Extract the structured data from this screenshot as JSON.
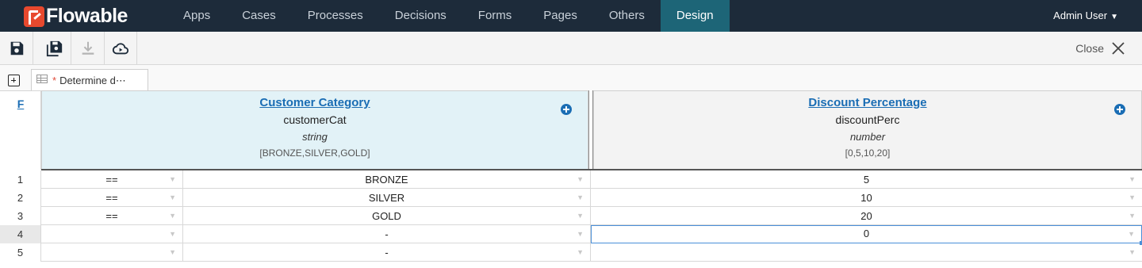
{
  "app": {
    "brand": "Flowable",
    "nav": [
      "Apps",
      "Cases",
      "Processes",
      "Decisions",
      "Forms",
      "Pages",
      "Others",
      "Design"
    ],
    "active_nav": "Design",
    "user": "Admin User"
  },
  "toolbar": {
    "buttons": [
      "save-icon",
      "save-all-icon",
      "download-icon",
      "cloud-publish-icon"
    ],
    "close_label": "Close"
  },
  "tab": {
    "modified_marker": "*",
    "title": "Determine d⋯"
  },
  "table": {
    "hit_policy": "F",
    "input_column": {
      "label": "Customer Category",
      "variable": "customerCat",
      "type": "string",
      "values": "[BRONZE,SILVER,GOLD]"
    },
    "output_column": {
      "label": "Discount Percentage",
      "variable": "discountPerc",
      "type": "number",
      "values": "[0,5,10,20]"
    },
    "rows": [
      {
        "num": "1",
        "op": "==",
        "input": "BRONZE",
        "output": "5"
      },
      {
        "num": "2",
        "op": "==",
        "input": "SILVER",
        "output": "10"
      },
      {
        "num": "3",
        "op": "==",
        "input": "GOLD",
        "output": "20"
      },
      {
        "num": "4",
        "op": "",
        "input": "-",
        "output": "0"
      },
      {
        "num": "5",
        "op": "",
        "input": "-",
        "output": ""
      }
    ],
    "selected_row": "4"
  },
  "colors": {
    "nav_bg": "#1d2b3a",
    "nav_active": "#1d6577",
    "brand_red": "#e8492e",
    "link_blue": "#1a6db4",
    "input_header_bg": "#e2f2f7",
    "selection": "#4a8fd8"
  }
}
